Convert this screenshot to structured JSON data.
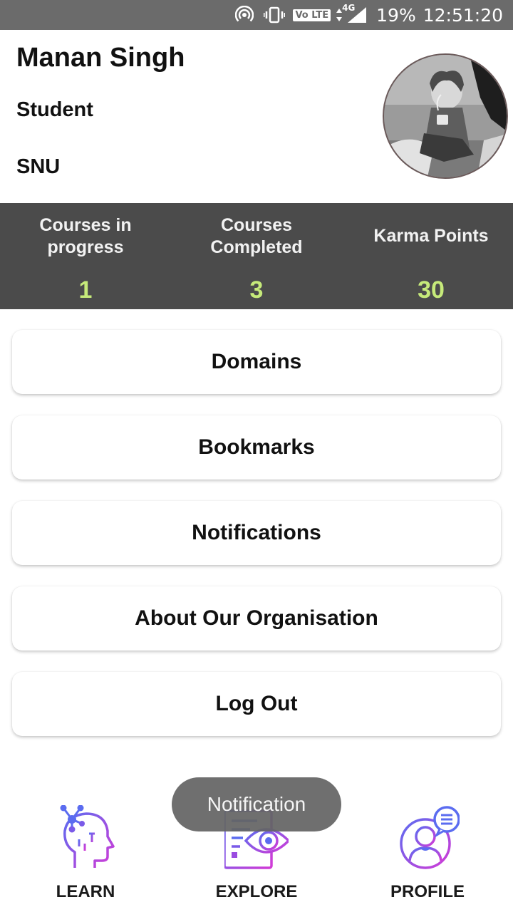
{
  "status_bar": {
    "volte_label": "Vo LTE",
    "network_label": "4G",
    "battery": "19%",
    "time": "12:51:20",
    "icons": [
      "hotspot-icon",
      "vibrate-icon",
      "volte-icon",
      "data-arrows-icon",
      "signal-icon"
    ]
  },
  "profile": {
    "name": "Manan Singh",
    "role": "Student",
    "organisation": "SNU",
    "avatar_icon": "avatar-illustration"
  },
  "stats": [
    {
      "label_line1": "Courses in",
      "label_line2": "progress",
      "value": "1"
    },
    {
      "label_line1": "Courses",
      "label_line2": "Completed",
      "value": "3"
    },
    {
      "label_line1": "Karma Points",
      "label_line2": "",
      "value": "30"
    }
  ],
  "menu": [
    {
      "label": "Domains"
    },
    {
      "label": "Bookmarks"
    },
    {
      "label": "Notifications"
    },
    {
      "label": "About Our Organisation"
    },
    {
      "label": "Log Out"
    }
  ],
  "bottom_nav": [
    {
      "label": "LEARN",
      "icon": "learn-head-icon"
    },
    {
      "label": "EXPLORE",
      "icon": "explore-book-eye-icon"
    },
    {
      "label": "PROFILE",
      "icon": "profile-user-chat-icon"
    }
  ],
  "toast": {
    "text": "Notification"
  },
  "colors": {
    "status_bar_bg": "#6b6b6b",
    "stats_band_bg": "#4b4b4b",
    "stat_value": "#c6ea7a",
    "icon_gradient_start": "#5b6cf0",
    "icon_gradient_end": "#d23ad6"
  }
}
